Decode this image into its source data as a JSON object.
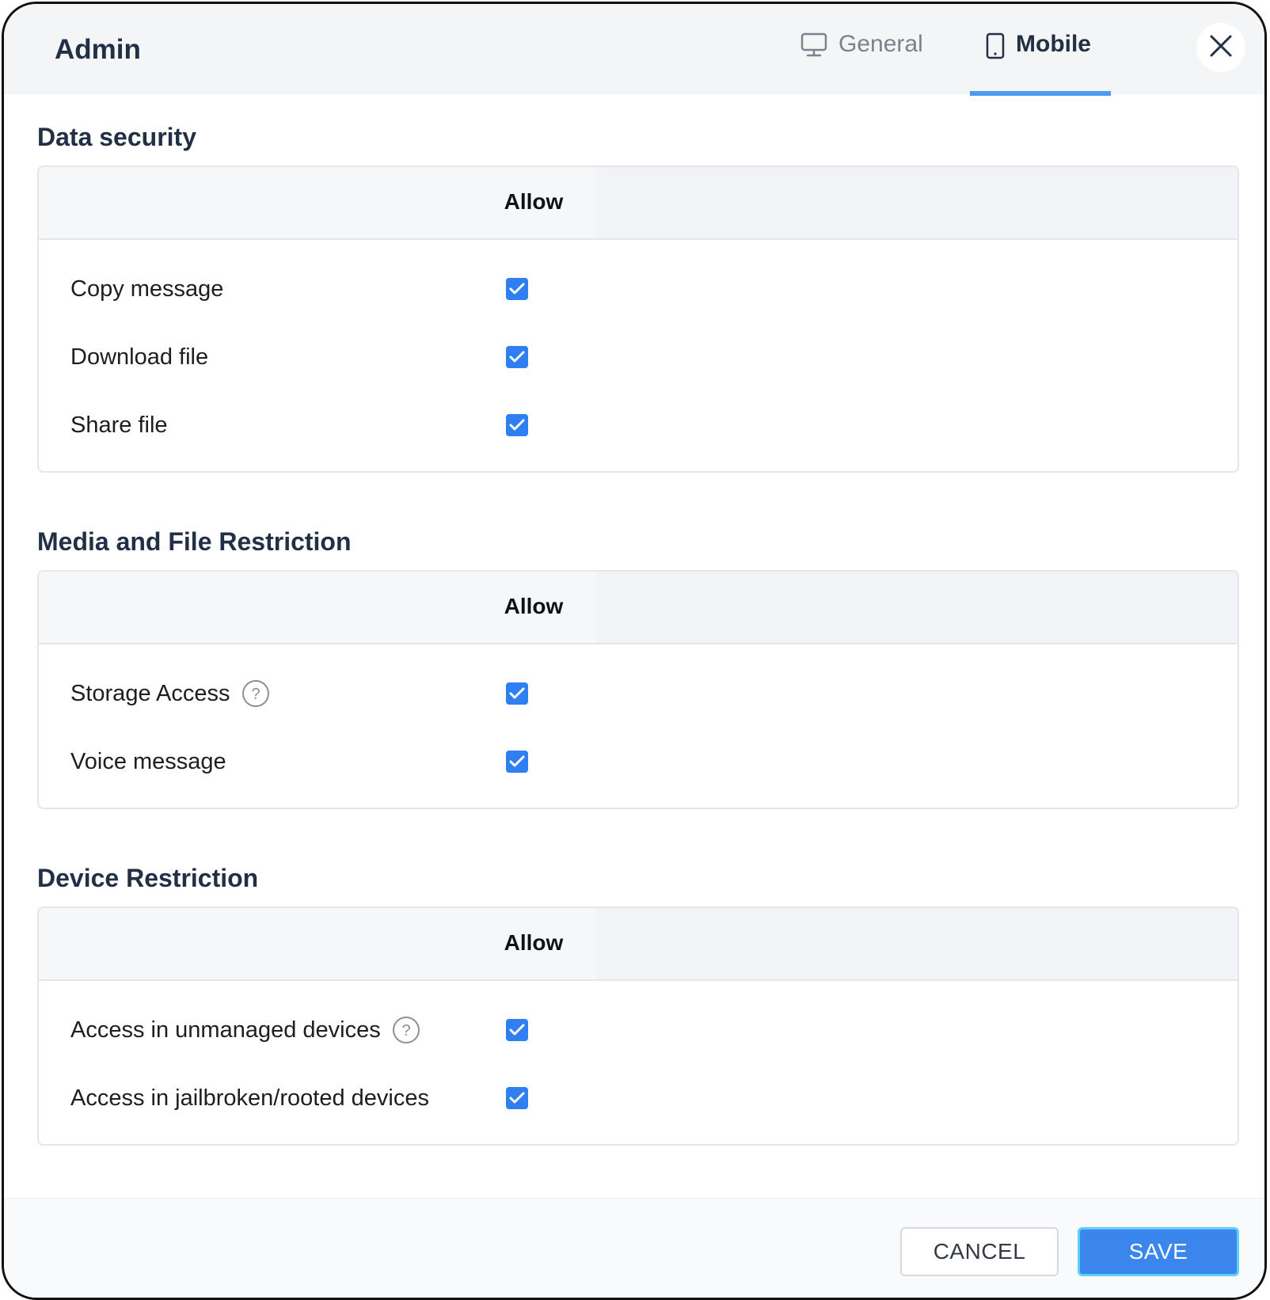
{
  "header": {
    "title": "Admin",
    "tabs": [
      {
        "label": "General",
        "icon": "monitor-icon",
        "active": false
      },
      {
        "label": "Mobile",
        "icon": "mobile-icon",
        "active": true
      }
    ],
    "close_icon": "close-icon"
  },
  "sections": [
    {
      "title": "Data security",
      "column_header": "Allow",
      "rows": [
        {
          "label": "Copy message",
          "checked": true,
          "help": false
        },
        {
          "label": "Download file",
          "checked": true,
          "help": false
        },
        {
          "label": "Share file",
          "checked": true,
          "help": false
        }
      ]
    },
    {
      "title": "Media and File Restriction",
      "column_header": "Allow",
      "rows": [
        {
          "label": "Storage Access",
          "checked": true,
          "help": true
        },
        {
          "label": "Voice message",
          "checked": true,
          "help": false
        }
      ]
    },
    {
      "title": "Device Restriction",
      "column_header": "Allow",
      "rows": [
        {
          "label": "Access in unmanaged devices",
          "checked": true,
          "help": true
        },
        {
          "label": "Access in jailbroken/rooted devices",
          "checked": true,
          "help": false
        }
      ]
    }
  ],
  "footer": {
    "cancel_label": "CANCEL",
    "save_label": "SAVE"
  },
  "colors": {
    "accent": "#3a86ec",
    "checkbox": "#2f7ef2",
    "tab_underline": "#4a9cf0",
    "heading": "#223046"
  }
}
